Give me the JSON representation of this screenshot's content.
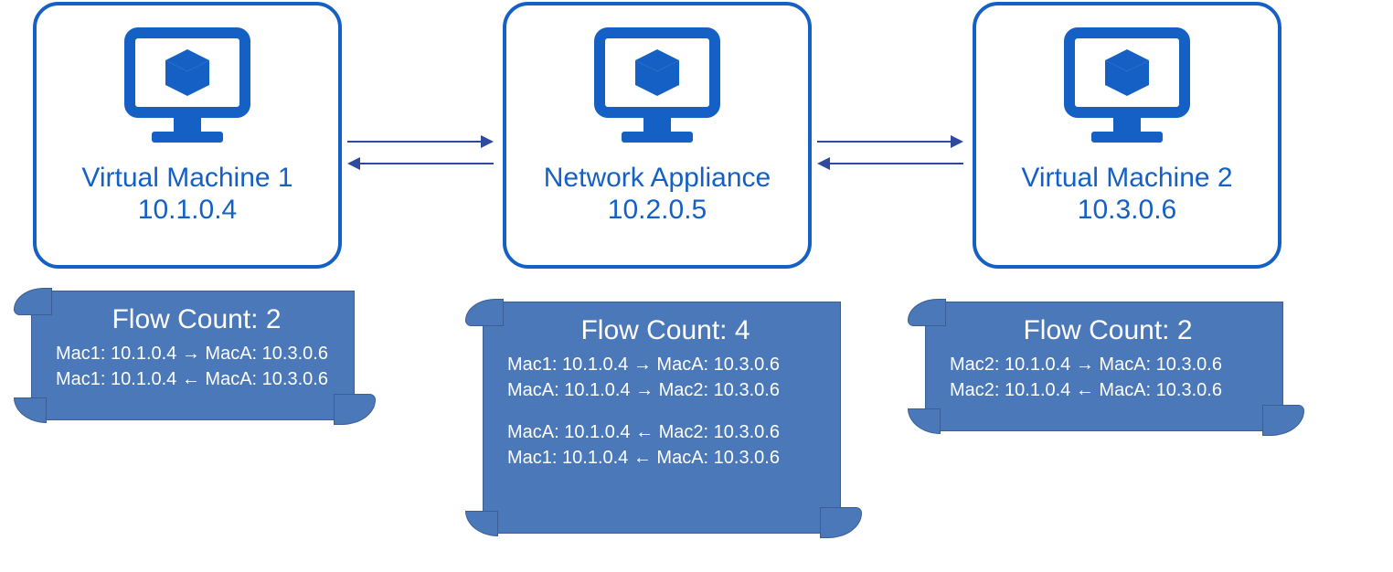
{
  "nodes": {
    "vm1": {
      "title": "Virtual Machine 1",
      "ip": "10.1.0.4"
    },
    "appliance": {
      "title": "Network Appliance",
      "ip": "10.2.0.5"
    },
    "vm2": {
      "title": "Virtual Machine 2",
      "ip": "10.3.0.6"
    }
  },
  "flows": {
    "vm1": {
      "title": "Flow Count: 2",
      "lines": [
        "Mac1: 10.1.0.4 → MacA: 10.3.0.6",
        "Mac1: 10.1.0.4 ← MacA: 10.3.0.6"
      ]
    },
    "appliance": {
      "title": "Flow Count: 4",
      "lines_a": [
        "Mac1: 10.1.0.4 → MacA: 10.3.0.6",
        "MacA: 10.1.0.4 → Mac2: 10.3.0.6"
      ],
      "lines_b": [
        "MacA: 10.1.0.4 ← Mac2: 10.3.0.6",
        "Mac1: 10.1.0.4 ← MacA: 10.3.0.6"
      ]
    },
    "vm2": {
      "title": "Flow Count: 2",
      "lines": [
        "Mac2: 10.1.0.4 → MacA: 10.3.0.6",
        "Mac2: 10.1.0.4 ← MacA: 10.3.0.6"
      ]
    }
  }
}
